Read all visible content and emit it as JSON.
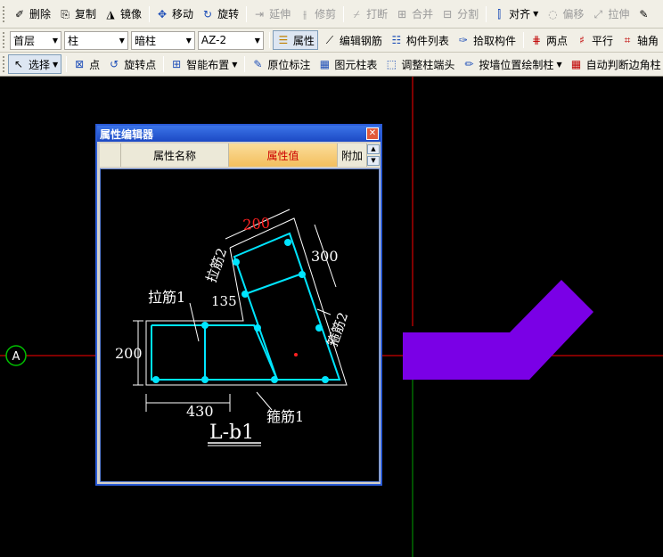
{
  "toolbar1": {
    "items": [
      {
        "label": "删除",
        "icon": "eraser-icon",
        "enabled": true
      },
      {
        "label": "复制",
        "icon": "copy-icon",
        "enabled": true
      },
      {
        "label": "镜像",
        "icon": "mirror-icon",
        "enabled": true
      },
      {
        "label": "移动",
        "icon": "move-icon",
        "enabled": true
      },
      {
        "label": "旋转",
        "icon": "rotate-icon",
        "enabled": true
      },
      {
        "label": "延伸",
        "icon": "extend-icon",
        "enabled": false
      },
      {
        "label": "修剪",
        "icon": "trim-icon",
        "enabled": false
      },
      {
        "label": "打断",
        "icon": "break-icon",
        "enabled": false
      },
      {
        "label": "合并",
        "icon": "merge-icon",
        "enabled": false
      },
      {
        "label": "分割",
        "icon": "split-icon",
        "enabled": false
      },
      {
        "label": "对齐",
        "icon": "align-icon",
        "enabled": true
      },
      {
        "label": "偏移",
        "icon": "offset-icon",
        "enabled": false
      },
      {
        "label": "拉伸",
        "icon": "stretch-icon",
        "enabled": false
      }
    ]
  },
  "toolbar2": {
    "floor": "首层",
    "category": "柱",
    "type": "暗柱",
    "component": "AZ-2",
    "properties": "属性",
    "edit_rebar": "编辑钢筋",
    "component_list": "构件列表",
    "pick_component": "拾取构件",
    "two_points": "两点",
    "parallel": "平行",
    "axis_angle": "轴角"
  },
  "toolbar3": {
    "select": "选择",
    "point": "点",
    "rotate_point": "旋转点",
    "smart_layout": "智能布置",
    "original_mark": "原位标注",
    "element_table": "图元柱表",
    "adjust_end": "调整柱端头",
    "wall_draw": "按墙位置绘制柱",
    "auto_corner": "自动判断边角柱"
  },
  "canvas": {
    "axis_label": "A",
    "colors": {
      "axis_red": "#ff0000",
      "axis_green": "#00a000",
      "column_purple": "#7a00e6"
    }
  },
  "editor": {
    "title": "属性编辑器",
    "col_name": "属性名称",
    "col_value": "属性值",
    "col_extra": "附加",
    "drawing": {
      "dim_top": "200",
      "dim_right": "300",
      "dim_left": "200",
      "dim_bottom": "430",
      "angle": "135",
      "tie_bar1": "拉筋1",
      "tie_bar2": "拉筋2",
      "stirrup1": "箍筋1",
      "stirrup2": "箍筋2",
      "name": "L-b1"
    }
  }
}
